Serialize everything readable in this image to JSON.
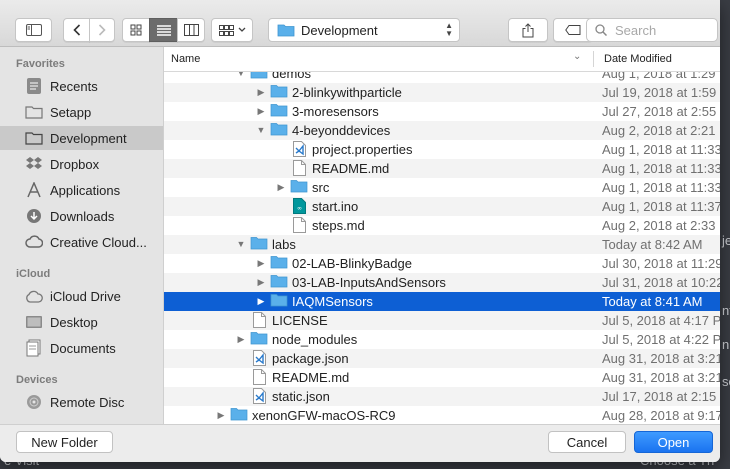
{
  "background_hints": [
    "je",
    "nt",
    "n",
    "sc",
    "na",
    "e Visit",
    "Choose a Th"
  ],
  "toolbar": {
    "location": "Development",
    "search_placeholder": "Search"
  },
  "sidebar": {
    "favorites_header": "Favorites",
    "favorites": [
      {
        "label": "Recents",
        "icon": "recents-icon"
      },
      {
        "label": "Setapp",
        "icon": "folder-icon"
      },
      {
        "label": "Development",
        "icon": "folder-icon",
        "selected": true
      },
      {
        "label": "Dropbox",
        "icon": "dropbox-icon"
      },
      {
        "label": "Applications",
        "icon": "applications-icon"
      },
      {
        "label": "Downloads",
        "icon": "downloads-icon"
      },
      {
        "label": "Creative Cloud...",
        "icon": "creative-cloud-icon"
      }
    ],
    "icloud_header": "iCloud",
    "icloud": [
      {
        "label": "iCloud Drive",
        "icon": "cloud-icon"
      },
      {
        "label": "Desktop",
        "icon": "desktop-icon"
      },
      {
        "label": "Documents",
        "icon": "documents-icon"
      }
    ],
    "devices_header": "Devices",
    "devices": [
      {
        "label": "Remote Disc",
        "icon": "disc-icon"
      }
    ]
  },
  "list": {
    "col_name": "Name",
    "col_date": "Date Modified",
    "rows": [
      {
        "name": "demos",
        "date": "Aug 1, 2018 at 1:29",
        "level": 1,
        "disc": "open",
        "type": "folder"
      },
      {
        "name": "2-blinkywithparticle",
        "date": "Jul 19, 2018 at 1:59",
        "level": 2,
        "disc": "closed",
        "type": "folder"
      },
      {
        "name": "3-moresensors",
        "date": "Jul 27, 2018 at 2:55",
        "level": 2,
        "disc": "closed",
        "type": "folder"
      },
      {
        "name": "4-beyonddevices",
        "date": "Aug 2, 2018 at 2:21",
        "level": 2,
        "disc": "open",
        "type": "folder"
      },
      {
        "name": "project.properties",
        "date": "Aug 1, 2018 at 11:33",
        "level": 3,
        "disc": "",
        "type": "vscode"
      },
      {
        "name": "README.md",
        "date": "Aug 1, 2018 at 11:33",
        "level": 3,
        "disc": "",
        "type": "doc"
      },
      {
        "name": "src",
        "date": "Aug 1, 2018 at 11:33",
        "level": 3,
        "disc": "closed",
        "type": "folder"
      },
      {
        "name": "start.ino",
        "date": "Aug 1, 2018 at 11:37",
        "level": 3,
        "disc": "",
        "type": "ino"
      },
      {
        "name": "steps.md",
        "date": "Aug 2, 2018 at 2:33",
        "level": 3,
        "disc": "",
        "type": "doc"
      },
      {
        "name": "labs",
        "date": "Today at 8:42 AM",
        "level": 1,
        "disc": "open",
        "type": "folder"
      },
      {
        "name": "02-LAB-BlinkyBadge",
        "date": "Jul 30, 2018 at 11:29",
        "level": 2,
        "disc": "closed",
        "type": "folder"
      },
      {
        "name": "03-LAB-InputsAndSensors",
        "date": "Jul 31, 2018 at 10:22",
        "level": 2,
        "disc": "closed",
        "type": "folder"
      },
      {
        "name": "IAQMSensors",
        "date": "Today at 8:41 AM",
        "level": 2,
        "disc": "closed",
        "type": "folder",
        "selected": true
      },
      {
        "name": "LICENSE",
        "date": "Jul 5, 2018 at 4:17 P",
        "level": 1,
        "disc": "",
        "type": "doc"
      },
      {
        "name": "node_modules",
        "date": "Jul 5, 2018 at 4:22 P",
        "level": 1,
        "disc": "closed",
        "type": "folder"
      },
      {
        "name": "package.json",
        "date": "Aug 31, 2018 at 3:21",
        "level": 1,
        "disc": "",
        "type": "vscode"
      },
      {
        "name": "README.md",
        "date": "Aug 31, 2018 at 3:21",
        "level": 1,
        "disc": "",
        "type": "doc"
      },
      {
        "name": "static.json",
        "date": "Jul 17, 2018 at 2:15",
        "level": 1,
        "disc": "",
        "type": "vscode"
      },
      {
        "name": "xenonGFW-macOS-RC9",
        "date": "Aug 28, 2018 at 9:17",
        "level": 0,
        "disc": "closed",
        "type": "folder"
      }
    ]
  },
  "bottom": {
    "new_folder": "New Folder",
    "cancel": "Cancel",
    "open": "Open"
  },
  "colors": {
    "accent": "#0d5fd4",
    "folder": "#5ab0ea",
    "sidebar_selected": "#c9c9c9"
  }
}
